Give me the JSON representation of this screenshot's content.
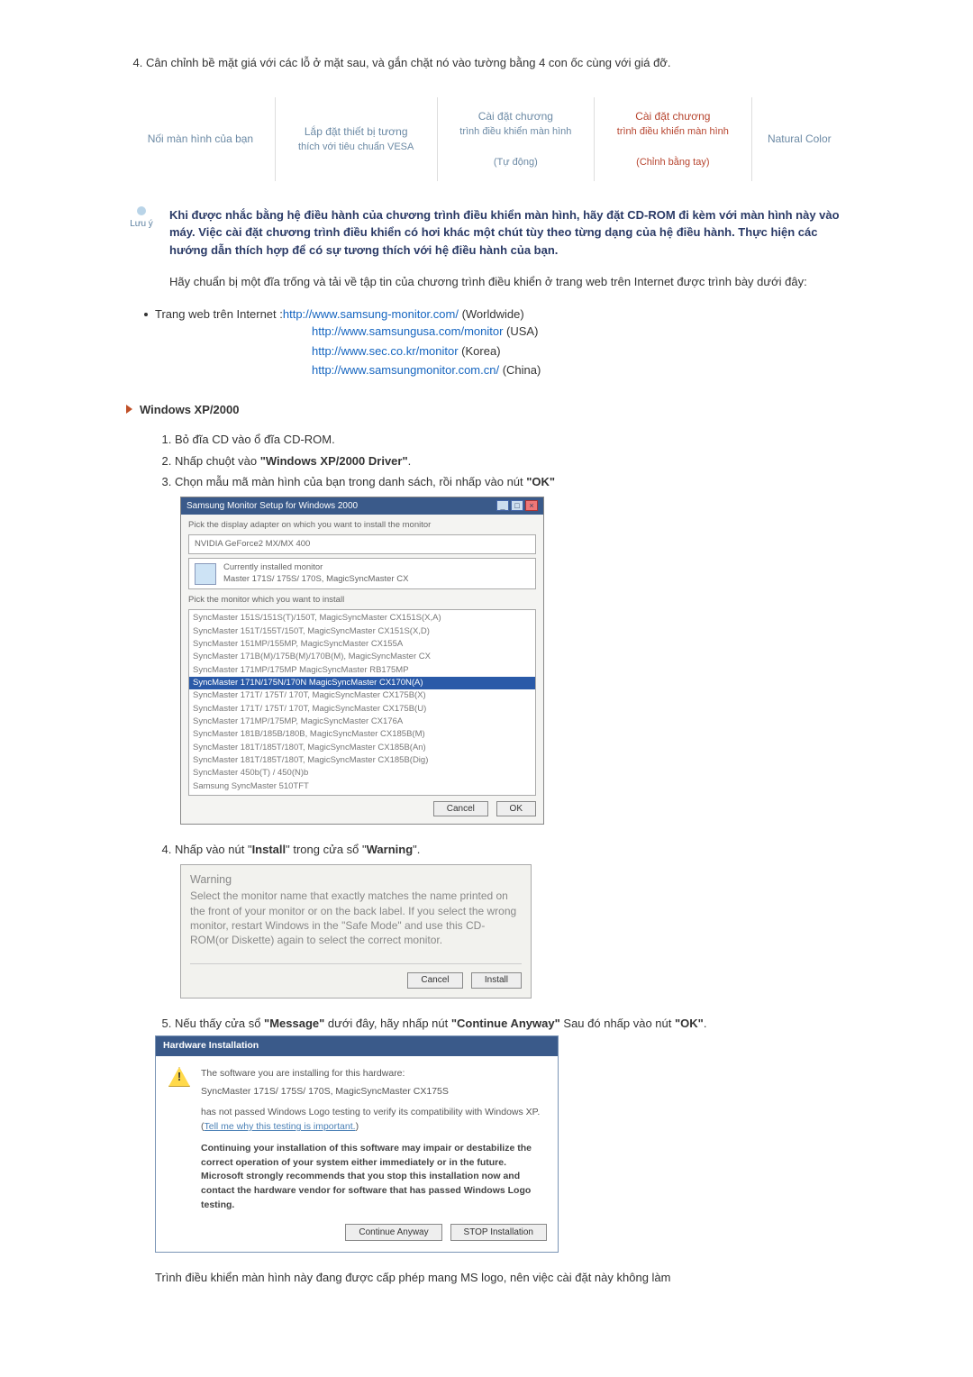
{
  "top_item_number_start": 4,
  "top_item_text": "Cân chỉnh bề mặt giá với các lỗ ở mặt sau, và gắn chặt nó vào tường bằng 4 con ốc cùng với giá đỡ.",
  "tabs": {
    "t1": "Nối màn hình của bạn",
    "t2_l1": "Lắp đặt thiết bị tương",
    "t2_l2": "thích với tiêu chuẩn VESA",
    "t3_l1": "Cài đặt chương",
    "t3_l2": "trình điều khiển màn hình",
    "t3_l3": "(Tự động)",
    "t4_l1": "Cài đặt chương",
    "t4_l2": "trình điều khiển màn hình",
    "t4_l3": "(Chỉnh bằng tay)",
    "t5": "Natural Color"
  },
  "note_icon_label": "Lưu ý",
  "note_bold": "Khi được nhắc bằng hệ điều hành của chương trình điều khiển màn hình, hãy đặt CD-ROM đi kèm với màn hình này vào máy. Việc cài đặt chương trình điều khiển có hơi khác một chút tùy theo từng dạng của hệ điều hành. Thực hiện các hướng dẫn thích hợp để có sự tương thích với hệ điều hành của bạn.",
  "note_para": "Hãy chuẩn bị một đĩa trống và tải về tập tin của chương trình điều khiển ở trang web trên Internet được trình bày dưới đây:",
  "web_label": "Trang web trên Internet :",
  "urls": {
    "u1": "http://www.samsung-monitor.com/",
    "u1_after": " (Worldwide)",
    "u2": "http://www.samsungusa.com/monitor",
    "u2_after": " (USA)",
    "u3": "http://www.sec.co.kr/monitor",
    "u3_after": " (Korea)",
    "u4": "http://www.samsungmonitor.com.cn/",
    "u4_after": " (China)"
  },
  "section_title": "Windows XP/2000",
  "steps": {
    "s1": "Bỏ đĩa CD vào ổ đĩa CD-ROM.",
    "s2_pre": "Nhấp chuột vào ",
    "s2_bold": "\"Windows XP/2000 Driver\"",
    "s2_post": ".",
    "s3_pre": "Chọn mẫu mã màn hình của bạn trong danh sách, rồi nhấp vào nút ",
    "s3_bold": "\"OK\"",
    "s4_pre": "Nhấp vào nút \"",
    "s4_b1": "Install",
    "s4_mid": "\" trong cửa sổ \"",
    "s4_b2": "Warning",
    "s4_post": "\".",
    "s5_pre": "Nếu thấy cửa sổ ",
    "s5_b1": "\"Message\"",
    "s5_mid": " dưới đây, hãy nhấp nút ",
    "s5_b2": "\"Continue Anyway\"",
    "s5_mid2": " Sau đó nhấp vào nút ",
    "s5_b3": "\"OK\"",
    "s5_post": "."
  },
  "dlg1": {
    "title": "Samsung Monitor Setup for Windows 2000",
    "line1": "Pick the display adapter on which you want to install the monitor",
    "adapter": "NVIDIA GeForce2 MX/MX 400",
    "cur_label": "Currently installed monitor",
    "cur_val": "Master 171S/ 175S/ 170S, MagicSyncMaster CX",
    "pick": "Pick the monitor which you want to install",
    "rows": [
      "SyncMaster 151S/151S(T)/150T, MagicSyncMaster CX151S(X,A)",
      "SyncMaster 151T/155T/150T, MagicSyncMaster CX151S(X,D)",
      "SyncMaster 151MP/155MP, MagicSyncMaster CX155A",
      "SyncMaster 171B(M)/175B(M)/170B(M), MagicSyncMaster CX",
      "SyncMaster 171MP/175MP MagicSyncMaster RB175MP",
      "SyncMaster 171N/175N/170N MagicSyncMaster CX170N(A)",
      "SyncMaster 171T/ 175T/ 170T, MagicSyncMaster CX175B(X)",
      "SyncMaster 171T/ 175T/ 170T, MagicSyncMaster CX175B(U)",
      "SyncMaster 171MP/175MP, MagicSyncMaster CX176A",
      "SyncMaster 181B/185B/180B, MagicSyncMaster CX185B(M)",
      "SyncMaster 181T/185T/180T, MagicSyncMaster CX185B(An)",
      "SyncMaster 181T/185T/180T, MagicSyncMaster CX185B(Dig)",
      "SyncMaster 450b(T) / 450(N)b",
      "Samsung SyncMaster 510TFT"
    ],
    "sel_index": 5,
    "btn_cancel": "Cancel",
    "btn_ok": "OK"
  },
  "dlg2": {
    "title": "Warning",
    "body": "Select the monitor name that exactly matches the name printed on the front of your monitor or on the back label. If you select the wrong monitor, restart Windows in the \"Safe Mode\" and use this CD-ROM(or Diskette) again to select the correct monitor.",
    "btn_cancel": "Cancel",
    "btn_install": "Install"
  },
  "dlg3": {
    "title": "Hardware Installation",
    "l1": "The software you are installing for this hardware:",
    "l2": "SyncMaster 171S/ 175S/ 170S, MagicSyncMaster CX175S",
    "l3a": "has not passed Windows Logo testing to verify its compatibility with Windows XP. (",
    "l3link": "Tell me why this testing is important.",
    "l3b": ")",
    "l4": "Continuing your installation of this software may impair or destabilize the correct operation of your system either immediately or in the future. Microsoft strongly recommends that you stop this installation now and contact the hardware vendor for software that has passed Windows Logo testing.",
    "btn_cont": "Continue Anyway",
    "btn_stop": "STOP Installation"
  },
  "final_line": "Trình điều khiển màn hình này đang được cấp phép mang MS logo, nên việc cài đặt này không làm"
}
